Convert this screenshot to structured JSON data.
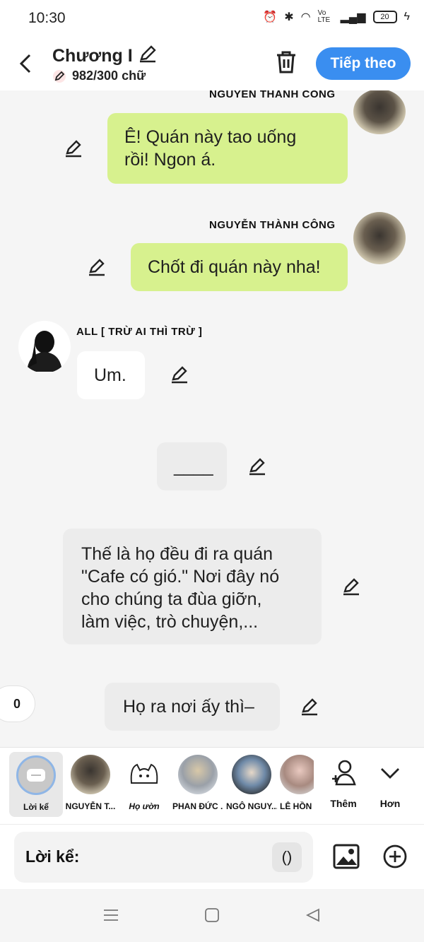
{
  "status": {
    "time": "10:30",
    "battery": "20",
    "network": "Vo LTE"
  },
  "header": {
    "title": "Chương I",
    "word_count": "982/300 chữ",
    "next_label": "Tiếp theo"
  },
  "messages": [
    {
      "name": "NGUYỄN THÀNH CÔNG",
      "text": [
        "Ê! Quán này tao uống",
        "rồi! Ngon á."
      ]
    },
    {
      "name": "NGUYỄN THÀNH CÔNG",
      "text": [
        "Chốt đi quán này nha!"
      ]
    },
    {
      "name": "ALL [ TRỪ AI THÌ TRỪ ]",
      "text": [
        "Um."
      ]
    },
    {
      "text": [
        "____"
      ]
    },
    {
      "text": [
        "Thế là họ đều đi ra quán",
        "\"Cafe có gió.\" Nơi đây nó",
        "cho chúng ta đùa giỡn,",
        "làm việc, trò chuyện,..."
      ]
    },
    {
      "text": [
        "Họ ra nơi ấy thì–"
      ]
    }
  ],
  "side_counter": "0",
  "characters": [
    {
      "label": "Lời kể"
    },
    {
      "label": "NGUYỄN T..."
    },
    {
      "label": "Họ ườn"
    },
    {
      "label": "PHAN ĐỨC ..."
    },
    {
      "label": "NGÔ NGUY..."
    },
    {
      "label": "LÊ HỒN"
    },
    {
      "label": "Thêm"
    },
    {
      "label": "Hơn"
    }
  ],
  "input": {
    "label": "Lời kể:",
    "paren": "()"
  },
  "colors": {
    "accent": "#3a8ef0",
    "bubble_green": "#d7f18e",
    "background": "#f5f5f5"
  }
}
